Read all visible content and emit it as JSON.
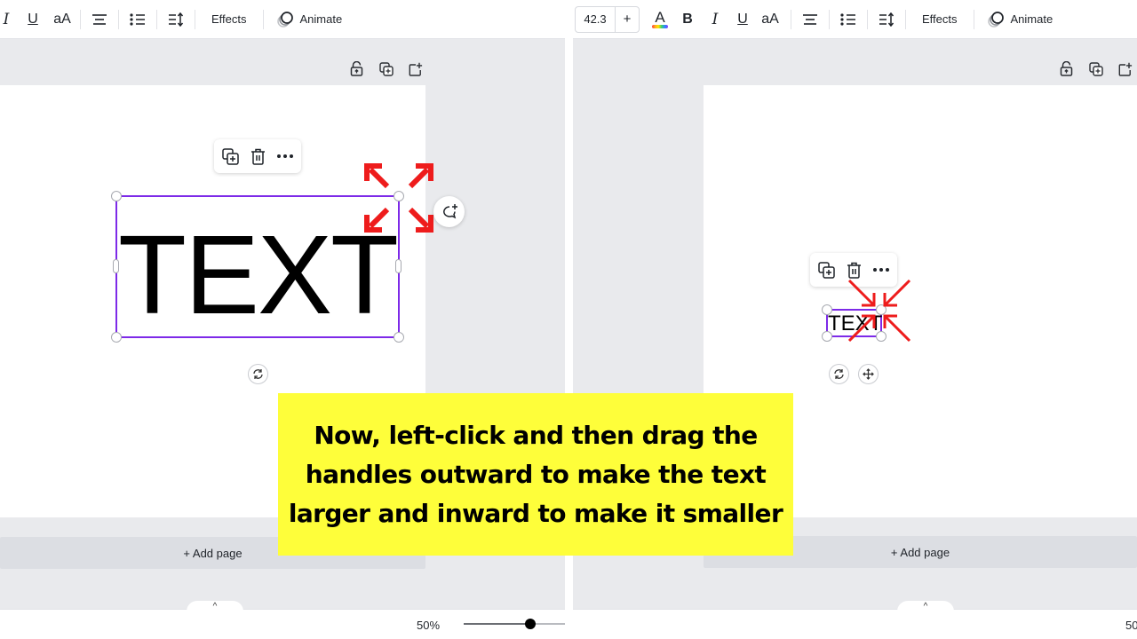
{
  "left_editor": {
    "toolbar": {
      "buttons": [
        {
          "name": "italic",
          "label": "I"
        },
        {
          "name": "underline",
          "label": "U"
        },
        {
          "name": "letter-case",
          "label": "aA"
        },
        {
          "name": "align-center",
          "icon": "align-center-icon"
        },
        {
          "name": "list",
          "icon": "bullet-list-icon"
        },
        {
          "name": "spacing",
          "icon": "line-spacing-icon"
        }
      ],
      "effects_label": "Effects",
      "animate_label": "Animate"
    },
    "page_actions": [
      "lock-icon",
      "duplicate-page-icon",
      "add-page-icon"
    ],
    "element_menu": [
      "duplicate-icon",
      "trash-icon",
      "more-icon"
    ],
    "text_element": "TEXT",
    "add_page_label": "+ Add page",
    "zoom": {
      "label": "50%",
      "value_percent": 50
    }
  },
  "right_editor": {
    "toolbar": {
      "font_size": "42.3",
      "font_size_increase": "+",
      "buttons": [
        {
          "name": "text-color",
          "label": "A"
        },
        {
          "name": "bold",
          "label": "B"
        },
        {
          "name": "italic",
          "label": "I"
        },
        {
          "name": "underline",
          "label": "U"
        },
        {
          "name": "letter-case",
          "label": "aA"
        },
        {
          "name": "align-center",
          "icon": "align-center-icon"
        },
        {
          "name": "list",
          "icon": "bullet-list-icon"
        },
        {
          "name": "spacing",
          "icon": "line-spacing-icon"
        }
      ],
      "effects_label": "Effects",
      "animate_label": "Animate"
    },
    "page_actions": [
      "lock-icon",
      "duplicate-page-icon",
      "add-page-icon"
    ],
    "element_menu": [
      "duplicate-icon",
      "trash-icon",
      "more-icon"
    ],
    "text_element": "TEXT",
    "add_page_label": "+ Add page",
    "zoom": {
      "label": "50"
    }
  },
  "annotations": {
    "arrow_color": "#ee1c1c",
    "left_arrows_direction": "outward",
    "right_arrows_direction": "inward"
  },
  "caption": {
    "text": "Now, left-click and then drag the handles outward to make the text larger and inward to make it smaller",
    "background": "#fefe3a"
  },
  "colors": {
    "selection": "#7d2ae8",
    "canvas_bg": "#e9eaed"
  }
}
